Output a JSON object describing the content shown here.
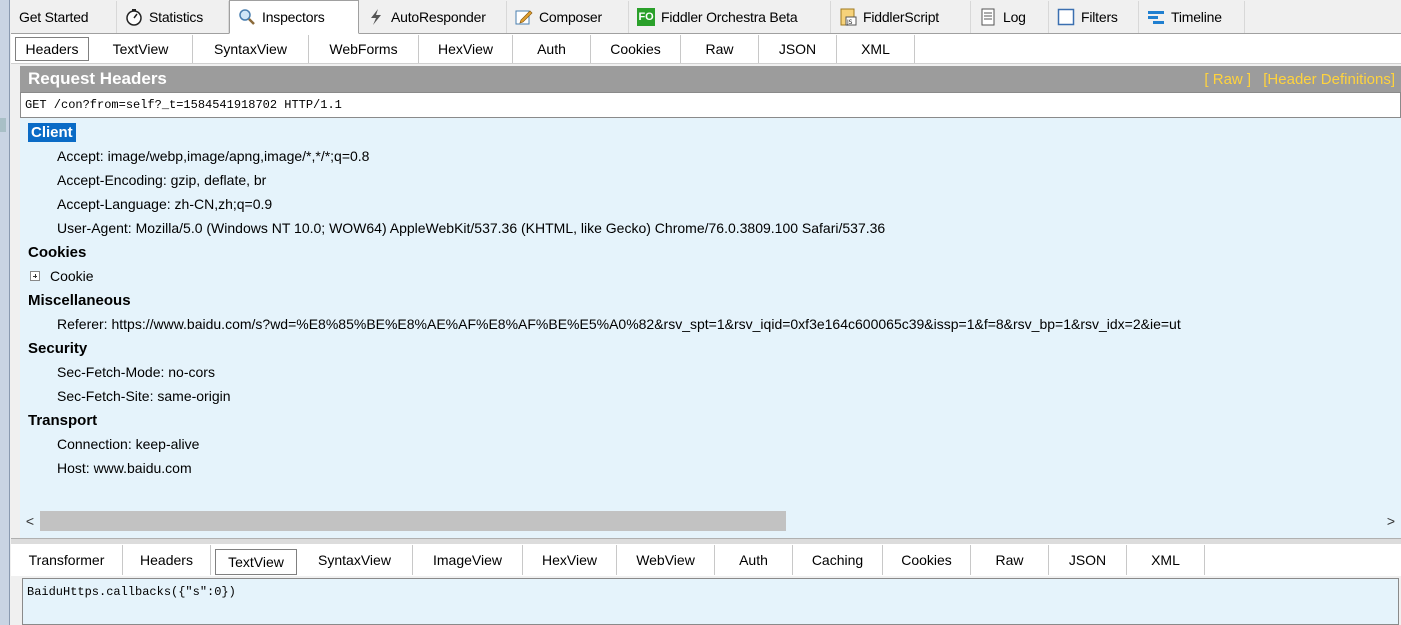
{
  "top_tabs": [
    {
      "label": "Get Started",
      "icon": ""
    },
    {
      "label": "Statistics",
      "icon": "stopwatch-icon"
    },
    {
      "label": "Inspectors",
      "icon": "magnifier-icon"
    },
    {
      "label": "AutoResponder",
      "icon": "lightning-icon"
    },
    {
      "label": "Composer",
      "icon": "pencil-icon"
    },
    {
      "label": "Fiddler Orchestra Beta",
      "icon": "fo-icon",
      "icon_text": "FO"
    },
    {
      "label": "FiddlerScript",
      "icon": "script-icon",
      "icon_text": "JS"
    },
    {
      "label": "Log",
      "icon": "log-icon"
    },
    {
      "label": "Filters",
      "icon": "checkbox-icon"
    },
    {
      "label": "Timeline",
      "icon": "timeline-icon"
    }
  ],
  "request_tabs": [
    "Headers",
    "TextView",
    "SyntaxView",
    "WebForms",
    "HexView",
    "Auth",
    "Cookies",
    "Raw",
    "JSON",
    "XML"
  ],
  "request": {
    "title": "Request Headers",
    "raw_link": "[ Raw ]",
    "definitions_link": "[Header Definitions]",
    "request_line": "GET /con?from=self?_t=1584541918702 HTTP/1.1",
    "groups": {
      "client": {
        "name": "Client",
        "items": [
          "Accept: image/webp,image/apng,image/*,*/*;q=0.8",
          "Accept-Encoding: gzip, deflate, br",
          "Accept-Language: zh-CN,zh;q=0.9",
          "User-Agent: Mozilla/5.0 (Windows NT 10.0; WOW64) AppleWebKit/537.36 (KHTML, like Gecko) Chrome/76.0.3809.100 Safari/537.36"
        ]
      },
      "cookies": {
        "name": "Cookies",
        "items": [
          "Cookie"
        ]
      },
      "misc": {
        "name": "Miscellaneous",
        "items": [
          "Referer: https://www.baidu.com/s?wd=%E8%85%BE%E8%AE%AF%E8%AF%BE%E5%A0%82&rsv_spt=1&rsv_iqid=0xf3e164c600065c39&issp=1&f=8&rsv_bp=1&rsv_idx=2&ie=ut"
        ]
      },
      "security": {
        "name": "Security",
        "items": [
          "Sec-Fetch-Mode: no-cors",
          "Sec-Fetch-Site: same-origin"
        ]
      },
      "transport": {
        "name": "Transport",
        "items": [
          "Connection: keep-alive",
          "Host: www.baidu.com"
        ]
      }
    }
  },
  "scroll_left": "<",
  "scroll_right": ">",
  "response_tabs": [
    "Transformer",
    "Headers",
    "TextView",
    "SyntaxView",
    "ImageView",
    "HexView",
    "WebView",
    "Auth",
    "Caching",
    "Cookies",
    "Raw",
    "JSON",
    "XML"
  ],
  "response": {
    "body_text": "BaiduHttps.callbacks({\"s\":0})"
  },
  "colors": {
    "selected_group": "#0a6bc6",
    "panel_bg": "#e5f3fb",
    "title_bar": "#9c9c9c",
    "title_links": "#ffd33d"
  }
}
